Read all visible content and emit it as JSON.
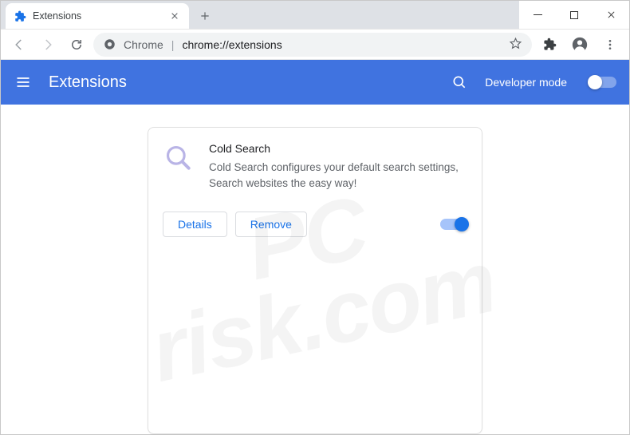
{
  "window": {
    "tab_title": "Extensions"
  },
  "omnibox": {
    "scheme_label": "Chrome",
    "url": "chrome://extensions"
  },
  "header": {
    "title": "Extensions",
    "dev_mode_label": "Developer mode",
    "dev_mode_on": false
  },
  "extension": {
    "name": "Cold Search",
    "description": "Cold Search configures your default search settings, Search websites the easy way!",
    "details_label": "Details",
    "remove_label": "Remove",
    "enabled": true
  },
  "watermark": {
    "line1": "PC",
    "line2": "risk.com"
  }
}
